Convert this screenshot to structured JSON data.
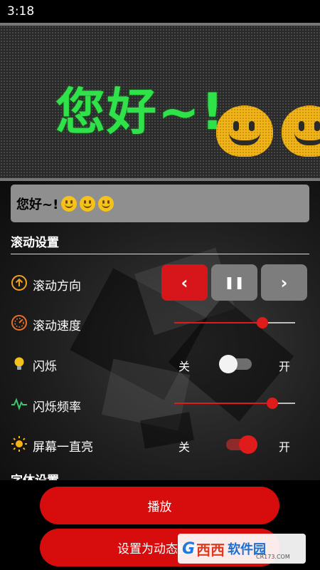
{
  "status_bar": {
    "time": "3:18"
  },
  "led": {
    "display_text": "您好~!",
    "text_color": "#2fe24a",
    "smiley_color": "#f2b416"
  },
  "input": {
    "value": "您好~!"
  },
  "scroll_settings": {
    "title": "滚动设置",
    "direction": {
      "label": "滚动方向",
      "left": "‹",
      "pause": "❚❚",
      "right": "›",
      "selected": "left"
    },
    "speed": {
      "label": "滚动速度",
      "value": 0.73
    },
    "blink": {
      "label": "闪烁",
      "off_label": "关",
      "on_label": "开",
      "enabled": false
    },
    "blink_freq": {
      "label": "闪烁频率",
      "value": 0.81
    },
    "screen_on": {
      "label": "屏幕一直亮",
      "off_label": "关",
      "on_label": "开",
      "enabled": true
    }
  },
  "font_settings": {
    "title": "字体设置"
  },
  "buttons": {
    "play": "播放",
    "set_wallpaper": "设置为动态壁纸"
  },
  "watermark": {
    "logo": "G",
    "brand_a": "西西",
    "brand_b": "软件园",
    "sub": "CR173.COM"
  },
  "colors": {
    "accent": "#d70c0c",
    "inactive_button": "#7d7d7d"
  }
}
